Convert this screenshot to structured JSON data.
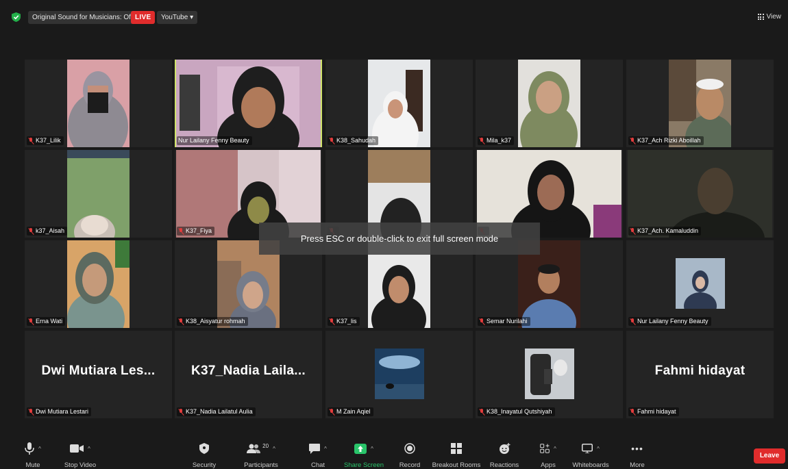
{
  "topbar": {
    "original_sound": "Original Sound for Musicians: Off",
    "live": "LIVE",
    "stream_target": "YouTube ▾",
    "view_label": "View"
  },
  "participants": [
    {
      "name": "K37_Lilik",
      "muted": true
    },
    {
      "name": "Nur Lailany Fenny Beauty",
      "muted": false,
      "active_speaker": true
    },
    {
      "name": "K38_Sahudah",
      "muted": true
    },
    {
      "name": "Mila_k37",
      "muted": true
    },
    {
      "name": "K37_Ach Rizki Aboillah",
      "muted": true
    },
    {
      "name": "k37_Aisah",
      "muted": true
    },
    {
      "name": "K37_Fiya",
      "muted": true
    },
    {
      "name": "",
      "muted": true
    },
    {
      "name": "",
      "muted": true
    },
    {
      "name": "K37_Ach. Kamaluddin",
      "muted": true
    },
    {
      "name": "Erna Wati",
      "muted": true
    },
    {
      "name": "K38_Aisyatur rohmah",
      "muted": true
    },
    {
      "name": "K37_lis",
      "muted": true
    },
    {
      "name": "Semar Nurilahi",
      "muted": true
    },
    {
      "name": "Nur Lailany Fenny Beauty",
      "muted": true
    },
    {
      "name": "Dwi Mutiara Lestari",
      "display": "Dwi Mutiara Les...",
      "muted": true
    },
    {
      "name": "K37_Nadia Lailatul Aulia",
      "display": "K37_Nadia Laila...",
      "muted": true
    },
    {
      "name": "M Zain Aqiel",
      "muted": true
    },
    {
      "name": "K38_Inayatul Qutshiyah",
      "muted": true
    },
    {
      "name": "Fahmi hidayat",
      "display": "Fahmi hidayat",
      "muted": true
    }
  ],
  "toast": "Press ESC or double-click to exit full screen mode",
  "toolbar": {
    "mute": "Mute",
    "stop_video": "Stop Video",
    "security": "Security",
    "participants": "Participants",
    "participant_count": "20",
    "chat": "Chat",
    "share_screen": "Share Screen",
    "record": "Record",
    "breakout_rooms": "Breakout Rooms",
    "reactions": "Reactions",
    "apps": "Apps",
    "whiteboards": "Whiteboards",
    "more": "More",
    "leave": "Leave"
  },
  "colors": {
    "background": "#1a1a1a",
    "tile": "#242424",
    "active_speaker_border": "#cfe36a",
    "live_red": "#e02c2c",
    "share_green": "#29c46a",
    "muted_red": "#e23c3c"
  }
}
